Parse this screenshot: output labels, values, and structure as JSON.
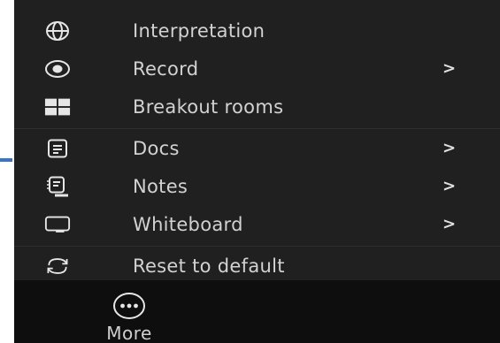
{
  "menu": {
    "items": [
      {
        "label": "Interpretation",
        "icon": "globe-icon",
        "has_submenu": false
      },
      {
        "label": "Record",
        "icon": "record-icon",
        "has_submenu": true
      },
      {
        "label": "Breakout rooms",
        "icon": "breakout-rooms-icon",
        "has_submenu": false
      },
      {
        "label": "Docs",
        "icon": "docs-icon",
        "has_submenu": true
      },
      {
        "label": "Notes",
        "icon": "notes-icon",
        "has_submenu": true
      },
      {
        "label": "Whiteboard",
        "icon": "whiteboard-icon",
        "has_submenu": true
      },
      {
        "label": "Reset to default",
        "icon": "reset-icon",
        "has_submenu": false
      }
    ],
    "chevron": ">"
  },
  "toolbar": {
    "more_label": "More",
    "more_icon": "more-icon"
  },
  "colors": {
    "menu_bg": "#202020",
    "toolbar_bg": "#0e0e0e",
    "text": "#d2d2d2",
    "accent": "#3a74c4"
  }
}
